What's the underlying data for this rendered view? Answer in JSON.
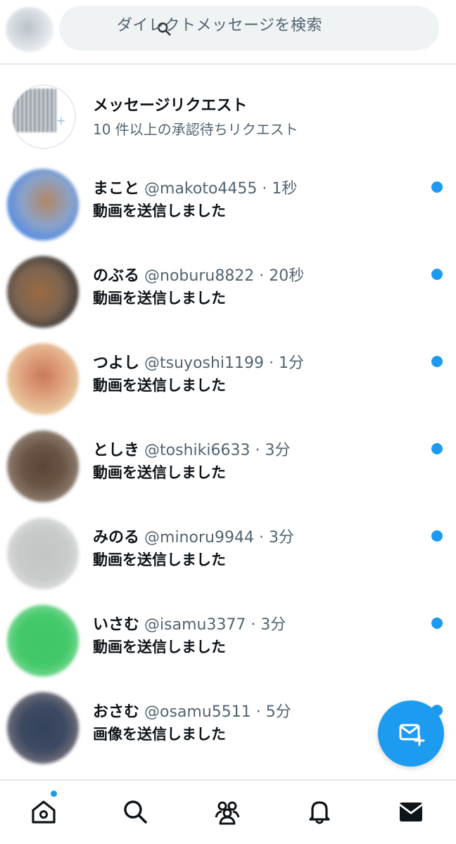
{
  "search": {
    "placeholder": "ダイレクトメッセージを検索"
  },
  "message_requests": {
    "title": "メッセージリクエスト",
    "subtitle": "10 件以上の承認待ちリクエスト"
  },
  "conversations": [
    {
      "name": "まこと",
      "handle": "@makoto4455",
      "time": "1秒",
      "preview": "動画を送信しました",
      "unread": true
    },
    {
      "name": "のぶる",
      "handle": "@noburu8822",
      "time": "20秒",
      "preview": "動画を送信しました",
      "unread": true
    },
    {
      "name": "つよし",
      "handle": "@tsuyoshi1199",
      "time": "1分",
      "preview": "動画を送信しました",
      "unread": true
    },
    {
      "name": "としき",
      "handle": "@toshiki6633",
      "time": "3分",
      "preview": "動画を送信しました",
      "unread": true
    },
    {
      "name": "みのる",
      "handle": "@minoru9944",
      "time": "3分",
      "preview": "動画を送信しました",
      "unread": true
    },
    {
      "name": "いさむ",
      "handle": "@isamu3377",
      "time": "3分",
      "preview": "動画を送信しました",
      "unread": true
    },
    {
      "name": "おさむ",
      "handle": "@osamu5511",
      "time": "5分",
      "preview": "画像を送信しました",
      "unread": true
    }
  ],
  "meta_separator": " · ",
  "icons": {
    "search": "search-icon",
    "compose": "new-message-icon",
    "nav": [
      "home-icon",
      "explore-icon",
      "communities-icon",
      "notifications-icon",
      "messages-icon"
    ]
  },
  "colors": {
    "accent": "#1d9bf0",
    "secondary_text": "#536471",
    "primary_text": "#0f1419"
  }
}
